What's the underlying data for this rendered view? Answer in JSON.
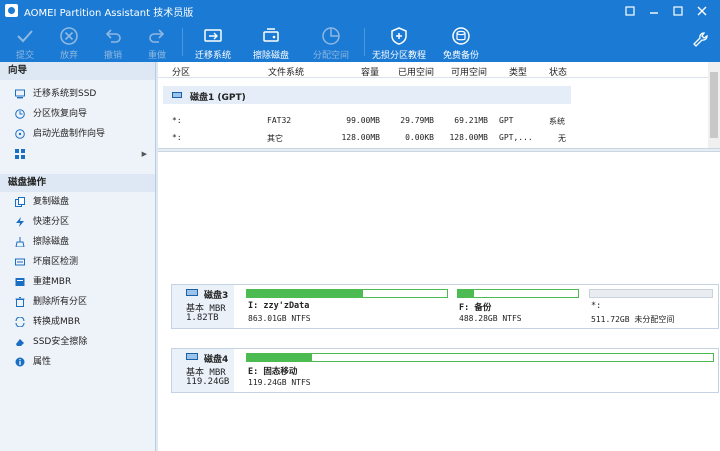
{
  "window": {
    "title": "AOMEI Partition Assistant 技术员版"
  },
  "toolbar": {
    "buttons": [
      {
        "label": "提交",
        "icon": "check-icon",
        "enabled": false
      },
      {
        "label": "放弃",
        "icon": "cancel-icon",
        "enabled": false
      },
      {
        "label": "撤销",
        "icon": "undo-icon",
        "enabled": false
      },
      {
        "label": "重做",
        "icon": "redo-icon",
        "enabled": false
      },
      {
        "label": "迁移系统",
        "icon": "migrate-os-icon",
        "enabled": true
      },
      {
        "label": "擦除磁盘",
        "icon": "wipe-disk-icon",
        "enabled": true
      },
      {
        "label": "分配空间",
        "icon": "allocate-space-icon",
        "enabled": false
      },
      {
        "label": "无损分区教程",
        "icon": "shield-plus-icon",
        "enabled": true
      },
      {
        "label": "免费备份",
        "icon": "backup-icon",
        "enabled": true
      }
    ]
  },
  "sidebar": {
    "wizard_header": "向导",
    "wizard_items": [
      {
        "label": "迁移系统到SSD",
        "icon": "migrate-ssd-icon"
      },
      {
        "label": "分区恢复向导",
        "icon": "partition-recovery-icon"
      },
      {
        "label": "启动光盘制作向导",
        "icon": "bootable-media-icon"
      },
      {
        "label": "",
        "icon": "more-grid-icon"
      }
    ],
    "disk_ops_header": "磁盘操作",
    "disk_ops_items": [
      {
        "label": "复制磁盘",
        "icon": "copy-disk-icon"
      },
      {
        "label": "快速分区",
        "icon": "quick-partition-icon"
      },
      {
        "label": "擦除磁盘",
        "icon": "wipe-disk-icon"
      },
      {
        "label": "坏扇区检测",
        "icon": "bad-sector-icon"
      },
      {
        "label": "重建MBR",
        "icon": "rebuild-mbr-icon"
      },
      {
        "label": "删除所有分区",
        "icon": "delete-partitions-icon"
      },
      {
        "label": "转换成MBR",
        "icon": "convert-mbr-icon"
      },
      {
        "label": "SSD安全擦除",
        "icon": "ssd-erase-icon"
      },
      {
        "label": "属性",
        "icon": "info-icon"
      }
    ]
  },
  "table": {
    "headers": [
      "分区",
      "文件系统",
      "容量",
      "已用空间",
      "可用空间",
      "类型",
      "状态"
    ],
    "disk_label": "磁盘1 (GPT)",
    "rows": [
      {
        "partition": "*:",
        "fs": "FAT32",
        "capacity": "99.00MB",
        "used": "29.79MB",
        "free": "69.21MB",
        "type": "GPT",
        "status": "系统"
      },
      {
        "partition": "*:",
        "fs": "其它",
        "capacity": "128.00MB",
        "used": "0.00KB",
        "free": "128.00MB",
        "type": "GPT,...",
        "status": "无"
      }
    ]
  },
  "disks": [
    {
      "name": "磁盘3",
      "type": "基本 MBR",
      "size": "1.82TB",
      "partitions": [
        {
          "name": "I: zzy'zData",
          "info": "863.01GB NTFS",
          "used_fraction": 0.58
        },
        {
          "name": "F: 备份",
          "info": "488.28GB NTFS",
          "used_fraction": 0.13
        },
        {
          "name": "*:",
          "info": "511.72GB 未分配空间",
          "used_fraction": 0
        }
      ]
    },
    {
      "name": "磁盘4",
      "type": "基本 MBR",
      "size": "119.24GB",
      "partitions": [
        {
          "name": "E: 固态移动",
          "info": "119.24GB NTFS",
          "used_fraction": 0.14
        }
      ]
    }
  ],
  "colors": {
    "titlebar": "#1b7ad3",
    "partition_used": "#4cbb52",
    "sidebar_bg": "#eef3f9"
  }
}
